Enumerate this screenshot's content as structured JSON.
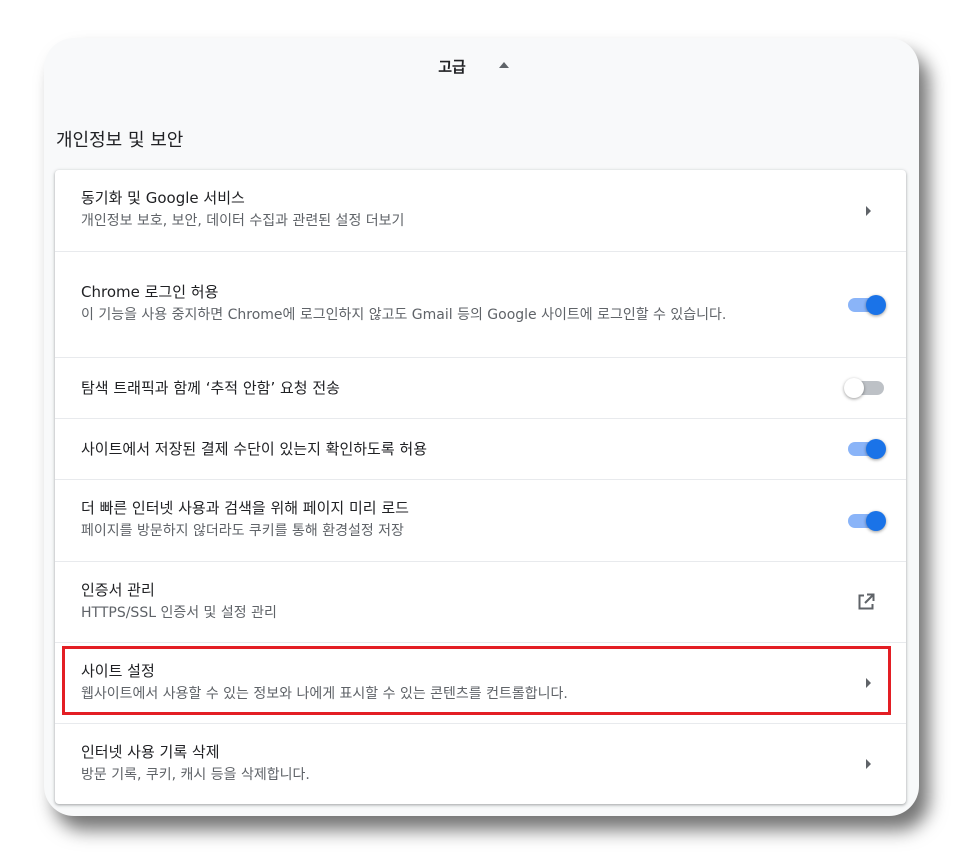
{
  "advanced": {
    "label": "고급"
  },
  "section": {
    "title": "개인정보 및 보안"
  },
  "rows": [
    {
      "title": "동기화 및 Google 서비스",
      "subtitle": "개인정보 보호, 보안, 데이터 수집과 관련된 설정 더보기",
      "control": "arrow"
    },
    {
      "title": "Chrome 로그인 허용",
      "subtitle": "이 기능을 사용 중지하면 Chrome에 로그인하지 않고도 Gmail 등의 Google 사이트에 로그인할 수 있습니다.",
      "control": "toggle",
      "checked": true
    },
    {
      "title": "탐색 트래픽과 함께 ‘추적 안함’ 요청 전송",
      "subtitle": "",
      "control": "toggle",
      "checked": false
    },
    {
      "title": "사이트에서 저장된 결제 수단이 있는지 확인하도록 허용",
      "subtitle": "",
      "control": "toggle",
      "checked": true
    },
    {
      "title": "더 빠른 인터넷 사용과 검색을 위해 페이지 미리 로드",
      "subtitle": "페이지를 방문하지 않더라도 쿠키를 통해 환경설정 저장",
      "control": "toggle",
      "checked": true
    },
    {
      "title": "인증서 관리",
      "subtitle": "HTTPS/SSL 인증서 및 설정 관리",
      "control": "external"
    },
    {
      "title": "사이트 설정",
      "subtitle": "웹사이트에서 사용할 수 있는 정보와 나에게 표시할 수 있는 콘텐츠를 컨트롤합니다.",
      "control": "arrow"
    },
    {
      "title": "인터넷 사용 기록 삭제",
      "subtitle": "방문 기록, 쿠키, 캐시 등을 삭제합니다.",
      "control": "arrow"
    }
  ],
  "colors": {
    "accent": "#1a73e8",
    "accent_track": "#8ab4f8",
    "highlight": "#e31e24"
  },
  "icons": {
    "arrow": "chevron-right-icon",
    "external": "open-in-new-icon",
    "collapse": "caret-up-icon"
  }
}
